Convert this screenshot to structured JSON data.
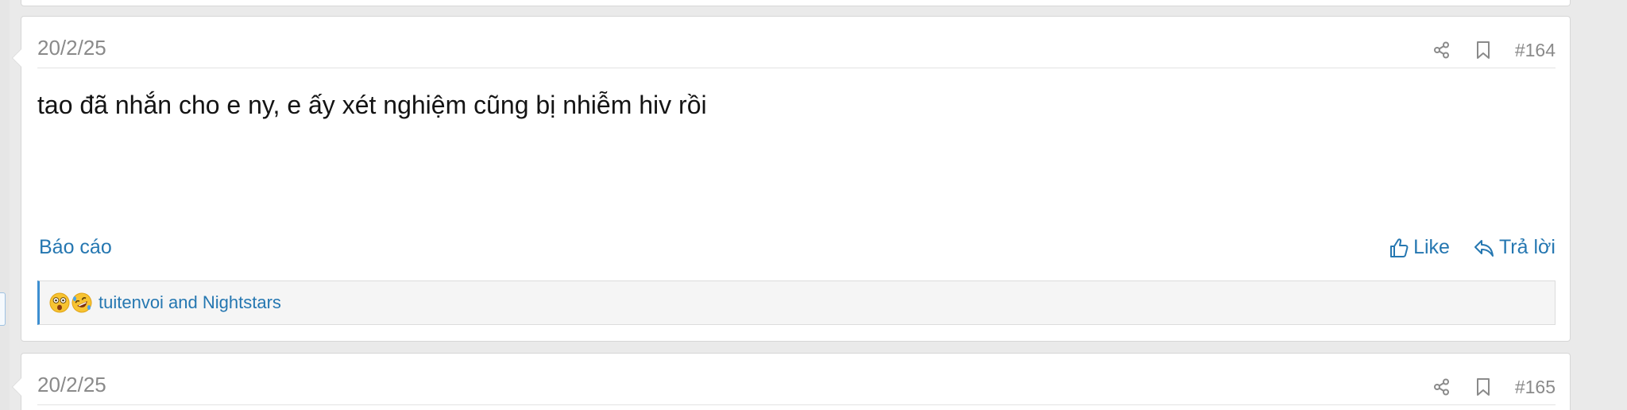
{
  "posts": [
    {
      "date": "20/2/25",
      "number": "#164",
      "body": "tao đã nhắn cho e ny, e ấy xét nghiệm cũng bị nhiễm hiv rồi",
      "report_label": "Báo cáo",
      "like_label": "Like",
      "reply_label": "Trả lời",
      "reaction_icons": [
        "astonished-face-icon",
        "rolling-on-floor-laughing-icon"
      ],
      "reactors_text": "tuitenvoi and Nightstars"
    },
    {
      "date": "20/2/25",
      "number": "#165"
    }
  ],
  "colors": {
    "link": "#2577b1",
    "reaction_accent": "#3d8fd1",
    "meta_text": "#8a8a8a"
  }
}
